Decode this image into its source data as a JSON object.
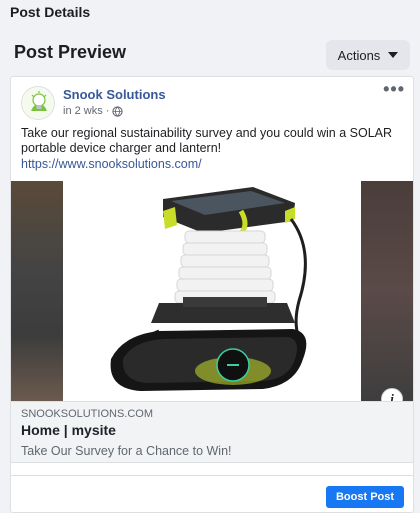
{
  "page": {
    "section_title": "Post Details",
    "preview_title": "Post Preview",
    "actions_label": "Actions"
  },
  "post": {
    "page_name": "Snook Solutions",
    "meta_time": "in 2 wks ·",
    "text": "Take our regional sustainability survey and you could win a SOLAR portable device charger and lantern!",
    "link_url": "https://www.snooksolutions.com/",
    "more_icon": "•••",
    "info_icon": "i"
  },
  "link_preview": {
    "domain": "SNOOKSOLUTIONS.COM",
    "title": "Home | mysite",
    "description": "Take Our Survey for a Chance to Win!"
  },
  "footer": {
    "boost_label": "Boost Post"
  },
  "colors": {
    "accent": "#1877f2",
    "link": "#385898",
    "product_yellow": "#c8dc2a"
  }
}
